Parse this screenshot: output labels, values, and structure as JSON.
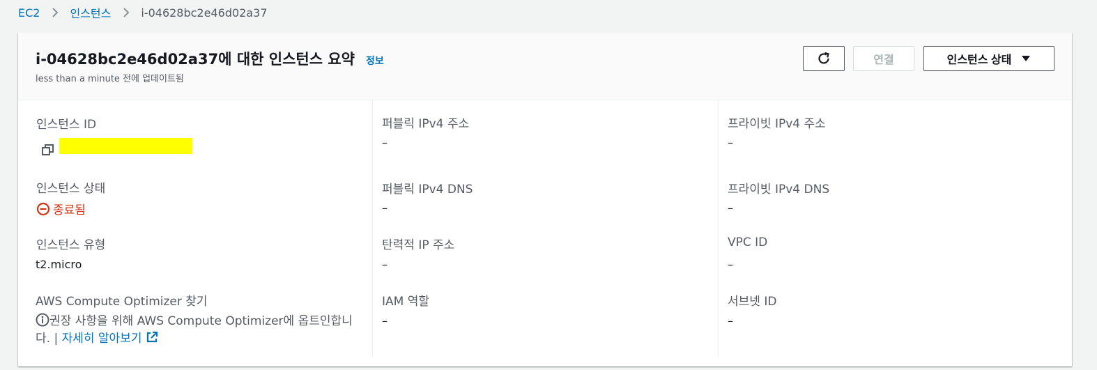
{
  "breadcrumb": {
    "items": [
      "EC2",
      "인스턴스"
    ],
    "current": "i-04628bc2e46d02a37"
  },
  "header": {
    "title": "i-04628bc2e46d02a37에 대한 인스턴스 요약",
    "info": "정보",
    "subtitle": "less than a minute 전에 업데이트됨",
    "connect_label": "연결",
    "state_label": "인스턴스 상태"
  },
  "details": {
    "instance_id": {
      "label": "인스턴스 ID",
      "value": ""
    },
    "instance_state": {
      "label": "인스턴스 상태",
      "value": "종료됨"
    },
    "instance_type": {
      "label": "인스턴스 유형",
      "value": "t2.micro"
    },
    "optimizer": {
      "label": "AWS Compute Optimizer 찾기",
      "text": "권장 사항을 위해 AWS Compute Optimizer에 옵트인합니다. | ",
      "link": "자세히 알아보기"
    },
    "public_ipv4": {
      "label": "퍼블릭 IPv4 주소",
      "value": "–"
    },
    "public_dns": {
      "label": "퍼블릭 IPv4 DNS",
      "value": "–"
    },
    "elastic_ip": {
      "label": "탄력적 IP 주소",
      "value": "–"
    },
    "iam_role": {
      "label": "IAM 역할",
      "value": "–"
    },
    "private_ipv4": {
      "label": "프라이빗 IPv4 주소",
      "value": "–"
    },
    "private_dns": {
      "label": "프라이빗 IPv4 DNS",
      "value": "–"
    },
    "vpc_id": {
      "label": "VPC ID",
      "value": "–"
    },
    "subnet_id": {
      "label": "서브넷 ID",
      "value": "–"
    }
  },
  "colors": {
    "link": "#0073bb",
    "terminated": "#d13212",
    "redaction": "#ffff00"
  },
  "icons": [
    "chevron-right-icon",
    "refresh-icon",
    "caret-down-icon",
    "copy-icon",
    "terminated-icon",
    "info-icon",
    "external-link-icon"
  ]
}
